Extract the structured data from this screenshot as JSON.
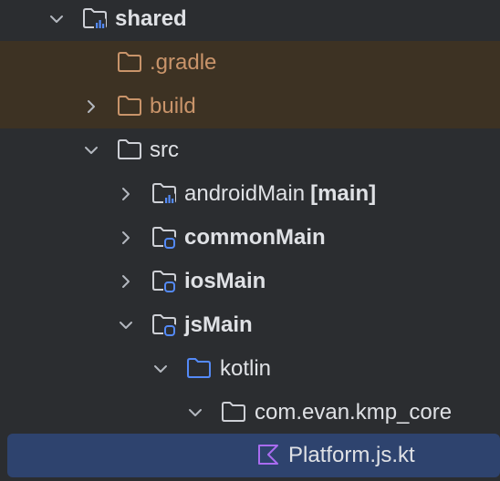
{
  "tree": {
    "items": [
      {
        "label": "shared",
        "suffix": "",
        "icon": "module-folder-icon"
      },
      {
        "label": ".gradle",
        "suffix": "",
        "icon": "excluded-folder-icon"
      },
      {
        "label": "build",
        "suffix": "",
        "icon": "excluded-folder-icon"
      },
      {
        "label": "src",
        "suffix": "",
        "icon": "folder-icon"
      },
      {
        "label": "androidMain",
        "suffix": "[main]",
        "icon": "module-folder-icon"
      },
      {
        "label": "commonMain",
        "suffix": "",
        "icon": "source-set-folder-icon"
      },
      {
        "label": "iosMain",
        "suffix": "",
        "icon": "source-set-folder-icon"
      },
      {
        "label": "jsMain",
        "suffix": "",
        "icon": "source-set-folder-icon"
      },
      {
        "label": "kotlin",
        "suffix": "",
        "icon": "source-root-folder-icon"
      },
      {
        "label": "com.evan.kmp_core",
        "suffix": "",
        "icon": "package-folder-icon"
      },
      {
        "label": "Platform.js.kt",
        "suffix": "",
        "icon": "kotlin-file-icon"
      }
    ]
  },
  "colors": {
    "background": "#2b2d30",
    "excluded_row": "#3d3223",
    "selection": "#2e436e",
    "text": "#dfe1e5",
    "excluded_text": "#c9946a",
    "accent_blue": "#548af7",
    "kotlin_purple": "#a96cf0"
  }
}
